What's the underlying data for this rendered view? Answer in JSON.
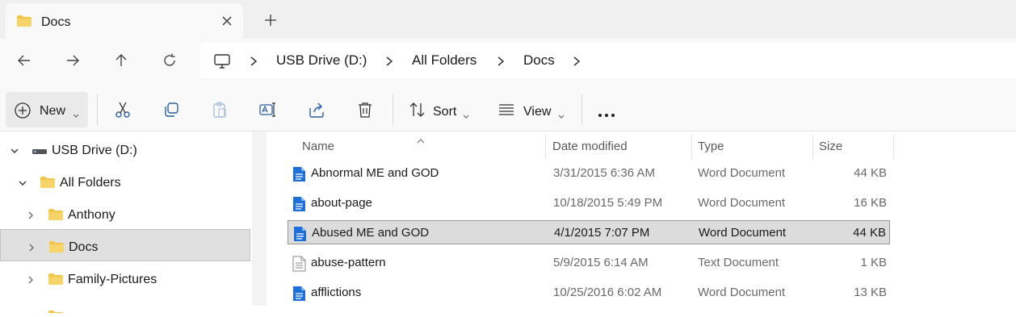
{
  "window": {
    "tab_title": "Docs"
  },
  "breadcrumb": [
    "USB Drive (D:)",
    "All Folders",
    "Docs"
  ],
  "toolbar": {
    "new_label": "New",
    "sort_label": "Sort",
    "view_label": "View"
  },
  "nav_pane": {
    "items": [
      {
        "label": "USB Drive (D:)",
        "icon": "drive-icon",
        "expanded": true
      },
      {
        "label": "All Folders",
        "icon": "folder-icon",
        "expanded": true
      },
      {
        "label": "Anthony",
        "icon": "folder-icon",
        "expanded": false
      },
      {
        "label": "Docs",
        "icon": "folder-icon",
        "expanded": false,
        "selected": true
      },
      {
        "label": "Family-Pictures",
        "icon": "folder-icon",
        "expanded": false
      }
    ]
  },
  "file_list": {
    "columns": [
      "Name",
      "Date modified",
      "Type",
      "Size"
    ],
    "sort_column": "Name",
    "rows": [
      {
        "name": "Abnormal ME and GOD",
        "date": "3/31/2015 6:36 AM",
        "type": "Word Document",
        "size": "44 KB",
        "icon": "word-document-icon"
      },
      {
        "name": "about-page",
        "date": "10/18/2015 5:49 PM",
        "type": "Word Document",
        "size": "16 KB",
        "icon": "word-document-icon"
      },
      {
        "name": "Abused ME and GOD",
        "date": "4/1/2015 7:07 PM",
        "type": "Word Document",
        "size": "44 KB",
        "icon": "word-document-icon",
        "selected": true
      },
      {
        "name": "abuse-pattern",
        "date": "5/9/2015 6:14 AM",
        "type": "Text Document",
        "size": "1 KB",
        "icon": "text-document-icon"
      },
      {
        "name": "afflictions",
        "date": "10/25/2016 6:02 AM",
        "type": "Word Document",
        "size": "13 KB",
        "icon": "word-document-icon"
      }
    ]
  },
  "colors": {
    "folder": "#f2c54b",
    "word_doc": "#1e6fd6",
    "selection": "#dcdcdc"
  }
}
